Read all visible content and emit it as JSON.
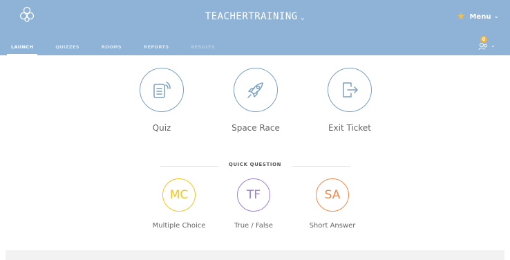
{
  "header": {
    "room_title": "TEACHERTRAINING",
    "menu_label": "Menu",
    "notification_count": "0"
  },
  "tabs": [
    {
      "label": "LAUNCH",
      "state": "active"
    },
    {
      "label": "QUIZZES",
      "state": "normal"
    },
    {
      "label": "ROOMS",
      "state": "normal"
    },
    {
      "label": "REPORTS",
      "state": "normal"
    },
    {
      "label": "RESULTS",
      "state": "disabled"
    }
  ],
  "activities": [
    {
      "label": "Quiz",
      "icon": "quiz-document-icon"
    },
    {
      "label": "Space Race",
      "icon": "rocket-icon"
    },
    {
      "label": "Exit Ticket",
      "icon": "exit-door-icon"
    }
  ],
  "quick_question": {
    "title": "QUICK QUESTION",
    "items": [
      {
        "abbr": "MC",
        "label": "Multiple Choice",
        "color": "#f3c623"
      },
      {
        "abbr": "TF",
        "label": "True / False",
        "color": "#9b7fd4"
      },
      {
        "abbr": "SA",
        "label": "Short Answer",
        "color": "#f08a4b"
      }
    ]
  },
  "colors": {
    "header_bg": "#8fb3d6",
    "icon_stroke": "#7a9fc4",
    "star": "#f1c04a"
  }
}
